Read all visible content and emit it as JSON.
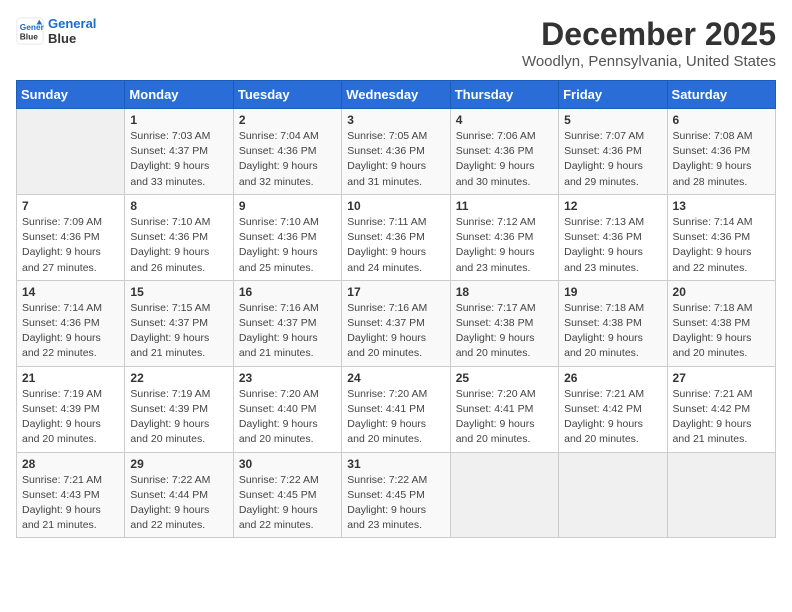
{
  "logo": {
    "line1": "General",
    "line2": "Blue"
  },
  "title": "December 2025",
  "subtitle": "Woodlyn, Pennsylvania, United States",
  "weekdays": [
    "Sunday",
    "Monday",
    "Tuesday",
    "Wednesday",
    "Thursday",
    "Friday",
    "Saturday"
  ],
  "weeks": [
    [
      {
        "day": "",
        "info": ""
      },
      {
        "day": "1",
        "info": "Sunrise: 7:03 AM\nSunset: 4:37 PM\nDaylight: 9 hours\nand 33 minutes."
      },
      {
        "day": "2",
        "info": "Sunrise: 7:04 AM\nSunset: 4:36 PM\nDaylight: 9 hours\nand 32 minutes."
      },
      {
        "day": "3",
        "info": "Sunrise: 7:05 AM\nSunset: 4:36 PM\nDaylight: 9 hours\nand 31 minutes."
      },
      {
        "day": "4",
        "info": "Sunrise: 7:06 AM\nSunset: 4:36 PM\nDaylight: 9 hours\nand 30 minutes."
      },
      {
        "day": "5",
        "info": "Sunrise: 7:07 AM\nSunset: 4:36 PM\nDaylight: 9 hours\nand 29 minutes."
      },
      {
        "day": "6",
        "info": "Sunrise: 7:08 AM\nSunset: 4:36 PM\nDaylight: 9 hours\nand 28 minutes."
      }
    ],
    [
      {
        "day": "7",
        "info": "Sunrise: 7:09 AM\nSunset: 4:36 PM\nDaylight: 9 hours\nand 27 minutes."
      },
      {
        "day": "8",
        "info": "Sunrise: 7:10 AM\nSunset: 4:36 PM\nDaylight: 9 hours\nand 26 minutes."
      },
      {
        "day": "9",
        "info": "Sunrise: 7:10 AM\nSunset: 4:36 PM\nDaylight: 9 hours\nand 25 minutes."
      },
      {
        "day": "10",
        "info": "Sunrise: 7:11 AM\nSunset: 4:36 PM\nDaylight: 9 hours\nand 24 minutes."
      },
      {
        "day": "11",
        "info": "Sunrise: 7:12 AM\nSunset: 4:36 PM\nDaylight: 9 hours\nand 23 minutes."
      },
      {
        "day": "12",
        "info": "Sunrise: 7:13 AM\nSunset: 4:36 PM\nDaylight: 9 hours\nand 23 minutes."
      },
      {
        "day": "13",
        "info": "Sunrise: 7:14 AM\nSunset: 4:36 PM\nDaylight: 9 hours\nand 22 minutes."
      }
    ],
    [
      {
        "day": "14",
        "info": "Sunrise: 7:14 AM\nSunset: 4:36 PM\nDaylight: 9 hours\nand 22 minutes."
      },
      {
        "day": "15",
        "info": "Sunrise: 7:15 AM\nSunset: 4:37 PM\nDaylight: 9 hours\nand 21 minutes."
      },
      {
        "day": "16",
        "info": "Sunrise: 7:16 AM\nSunset: 4:37 PM\nDaylight: 9 hours\nand 21 minutes."
      },
      {
        "day": "17",
        "info": "Sunrise: 7:16 AM\nSunset: 4:37 PM\nDaylight: 9 hours\nand 20 minutes."
      },
      {
        "day": "18",
        "info": "Sunrise: 7:17 AM\nSunset: 4:38 PM\nDaylight: 9 hours\nand 20 minutes."
      },
      {
        "day": "19",
        "info": "Sunrise: 7:18 AM\nSunset: 4:38 PM\nDaylight: 9 hours\nand 20 minutes."
      },
      {
        "day": "20",
        "info": "Sunrise: 7:18 AM\nSunset: 4:38 PM\nDaylight: 9 hours\nand 20 minutes."
      }
    ],
    [
      {
        "day": "21",
        "info": "Sunrise: 7:19 AM\nSunset: 4:39 PM\nDaylight: 9 hours\nand 20 minutes."
      },
      {
        "day": "22",
        "info": "Sunrise: 7:19 AM\nSunset: 4:39 PM\nDaylight: 9 hours\nand 20 minutes."
      },
      {
        "day": "23",
        "info": "Sunrise: 7:20 AM\nSunset: 4:40 PM\nDaylight: 9 hours\nand 20 minutes."
      },
      {
        "day": "24",
        "info": "Sunrise: 7:20 AM\nSunset: 4:41 PM\nDaylight: 9 hours\nand 20 minutes."
      },
      {
        "day": "25",
        "info": "Sunrise: 7:20 AM\nSunset: 4:41 PM\nDaylight: 9 hours\nand 20 minutes."
      },
      {
        "day": "26",
        "info": "Sunrise: 7:21 AM\nSunset: 4:42 PM\nDaylight: 9 hours\nand 20 minutes."
      },
      {
        "day": "27",
        "info": "Sunrise: 7:21 AM\nSunset: 4:42 PM\nDaylight: 9 hours\nand 21 minutes."
      }
    ],
    [
      {
        "day": "28",
        "info": "Sunrise: 7:21 AM\nSunset: 4:43 PM\nDaylight: 9 hours\nand 21 minutes."
      },
      {
        "day": "29",
        "info": "Sunrise: 7:22 AM\nSunset: 4:44 PM\nDaylight: 9 hours\nand 22 minutes."
      },
      {
        "day": "30",
        "info": "Sunrise: 7:22 AM\nSunset: 4:45 PM\nDaylight: 9 hours\nand 22 minutes."
      },
      {
        "day": "31",
        "info": "Sunrise: 7:22 AM\nSunset: 4:45 PM\nDaylight: 9 hours\nand 23 minutes."
      },
      {
        "day": "",
        "info": ""
      },
      {
        "day": "",
        "info": ""
      },
      {
        "day": "",
        "info": ""
      }
    ]
  ]
}
